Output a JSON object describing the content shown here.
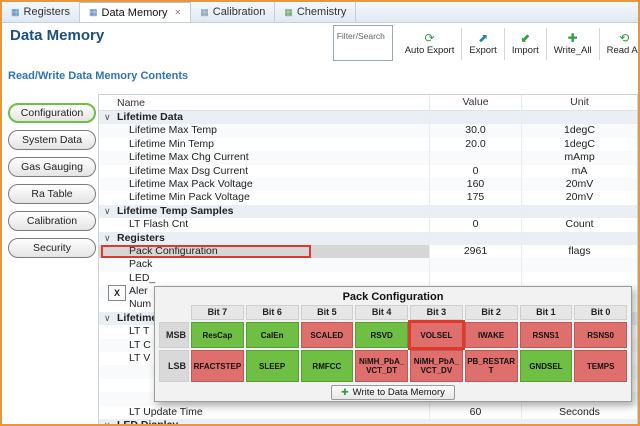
{
  "window": {
    "border_color": "#e8973a"
  },
  "colors": {
    "window_border": "#e8973a",
    "title": "#1c4e7e",
    "subheader": "#2e74b5",
    "section_bg": "#eaeff5",
    "selected_bg": "#d6d6d6",
    "highlight": "#e0392b"
  },
  "tabs": [
    {
      "label": "Registers",
      "icon": "registers-icon",
      "active": false,
      "closable": false
    },
    {
      "label": "Data Memory",
      "icon": "data-memory-icon",
      "active": true,
      "closable": true
    },
    {
      "label": "Calibration",
      "icon": "calibration-icon",
      "active": false,
      "closable": false
    },
    {
      "label": "Chemistry",
      "icon": "chemistry-icon",
      "active": false,
      "closable": false
    }
  ],
  "header": {
    "title": "Data Memory"
  },
  "toolbar": {
    "filter_placeholder": "Filter/Search",
    "buttons": [
      {
        "label": "Auto Export",
        "icon": "auto-export-icon"
      },
      {
        "label": "Export",
        "icon": "export-icon"
      },
      {
        "label": "Import",
        "icon": "import-icon"
      },
      {
        "label": "Write_All",
        "icon": "write-all-icon"
      },
      {
        "label": "Read All",
        "icon": "read-all-icon"
      }
    ]
  },
  "subheader": {
    "title": "Read/Write Data Memory Contents"
  },
  "sidebar": {
    "items": [
      {
        "label": "Configuration",
        "selected": true
      },
      {
        "label": "System Data",
        "selected": false
      },
      {
        "label": "Gas Gauging",
        "selected": false
      },
      {
        "label": "Ra Table",
        "selected": false
      },
      {
        "label": "Calibration",
        "selected": false
      },
      {
        "label": "Security",
        "selected": false
      }
    ]
  },
  "table": {
    "columns": [
      "Name",
      "Value",
      "Unit"
    ],
    "rows": [
      {
        "type": "section",
        "name": "Lifetime Data",
        "value": "",
        "unit": ""
      },
      {
        "type": "data",
        "name": "Lifetime Max Temp",
        "value": "30.0",
        "unit": "1degC"
      },
      {
        "type": "data",
        "name": "Lifetime Min Temp",
        "value": "20.0",
        "unit": "1degC"
      },
      {
        "type": "data",
        "name": "Lifetime Max Chg Current",
        "value": "",
        "unit": "mAmp"
      },
      {
        "type": "data",
        "name": "Lifetime Max Dsg Current",
        "value": "0",
        "unit": "mA"
      },
      {
        "type": "data",
        "name": "Lifetime Max Pack Voltage",
        "value": "160",
        "unit": "20mV"
      },
      {
        "type": "data",
        "name": "Lifetime Min Pack Voltage",
        "value": "175",
        "unit": "20mV"
      },
      {
        "type": "section",
        "name": "Lifetime Temp Samples",
        "value": "",
        "unit": ""
      },
      {
        "type": "data",
        "name": "LT Flash Cnt",
        "value": "0",
        "unit": "Count"
      },
      {
        "type": "section",
        "name": "Registers",
        "value": "",
        "unit": ""
      },
      {
        "type": "data",
        "name": "Pack Configuration",
        "value": "2961",
        "unit": "flags",
        "selected": true
      },
      {
        "type": "data",
        "name": "Pack",
        "value": "",
        "unit": ""
      },
      {
        "type": "data",
        "name": "LED_",
        "value": "",
        "unit": ""
      },
      {
        "type": "data",
        "name": "Aler",
        "value": "",
        "unit": ""
      },
      {
        "type": "data",
        "name": "Num",
        "value": "",
        "unit": ""
      },
      {
        "type": "section",
        "name": "Lifetime",
        "value": "",
        "unit": ""
      },
      {
        "type": "data",
        "name": "LT T",
        "value": "",
        "unit": ""
      },
      {
        "type": "data",
        "name": "LT C",
        "value": "",
        "unit": ""
      },
      {
        "type": "data",
        "name": "LT V",
        "value": "",
        "unit": ""
      },
      {
        "type": "data",
        "name": "",
        "value": "",
        "unit": ""
      },
      {
        "type": "data",
        "name": "",
        "value": "",
        "unit": ""
      },
      {
        "type": "data",
        "name": "",
        "value": "",
        "unit": ""
      },
      {
        "type": "data",
        "name": "LT Update Time",
        "value": "60",
        "unit": "Seconds"
      },
      {
        "type": "section",
        "name": "LED Display",
        "value": "",
        "unit": ""
      }
    ]
  },
  "popup": {
    "title": "Pack Configuration",
    "close_label": "X",
    "bit_headers": [
      "Bit 7",
      "Bit 6",
      "Bit 5",
      "Bit 4",
      "Bit 3",
      "Bit 2",
      "Bit 1",
      "Bit 0"
    ],
    "rows": [
      {
        "label": "MSB",
        "cells": [
          {
            "text": "ResCap",
            "state": "green"
          },
          {
            "text": "CalEn",
            "state": "green"
          },
          {
            "text": "SCALED",
            "state": "red"
          },
          {
            "text": "RSVD",
            "state": "green"
          },
          {
            "text": "VOLSEL",
            "state": "red",
            "highlight": true
          },
          {
            "text": "IWAKE",
            "state": "red"
          },
          {
            "text": "RSNS1",
            "state": "red"
          },
          {
            "text": "RSNS0",
            "state": "red"
          }
        ]
      },
      {
        "label": "LSB",
        "cells": [
          {
            "text": "RFACTSTEP",
            "state": "red"
          },
          {
            "text": "SLEEP",
            "state": "green"
          },
          {
            "text": "RMFCC",
            "state": "green"
          },
          {
            "text": "NiMH_PbA_VCT_DT",
            "state": "red"
          },
          {
            "text": "NiMH_PbA_VCT_DV",
            "state": "red"
          },
          {
            "text": "PB_RESTART",
            "state": "red"
          },
          {
            "text": "GNDSEL",
            "state": "green"
          },
          {
            "text": "TEMPS",
            "state": "red"
          }
        ]
      }
    ],
    "write_button": "Write to Data Memory",
    "colors": {
      "green": "#6fbf44",
      "red": "#df6f6d",
      "highlight": "#e0392b"
    }
  }
}
